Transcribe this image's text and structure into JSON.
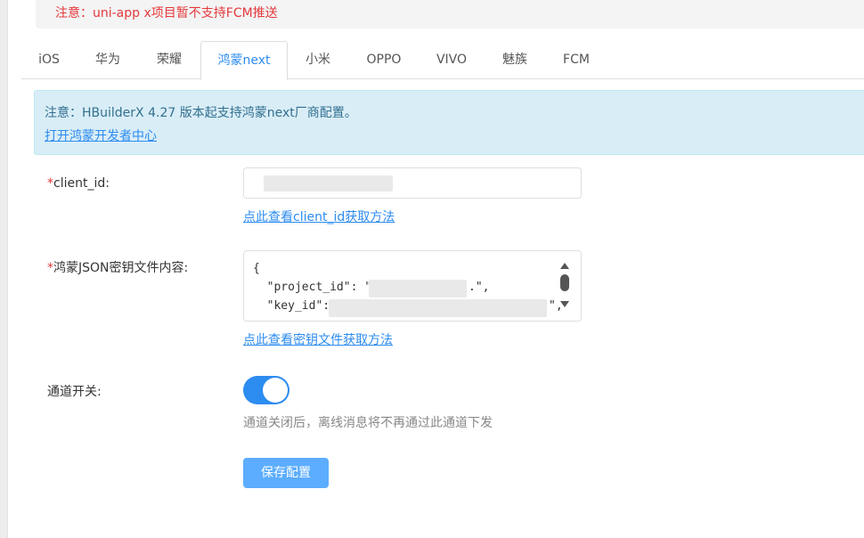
{
  "notice": {
    "text": "注意：uni-app x项目暂不支持FCM推送"
  },
  "tabs": [
    {
      "label": "iOS"
    },
    {
      "label": "华为"
    },
    {
      "label": "荣耀"
    },
    {
      "label": "鸿蒙next",
      "active": true
    },
    {
      "label": "小米"
    },
    {
      "label": "OPPO"
    },
    {
      "label": "VIVO"
    },
    {
      "label": "魅族"
    },
    {
      "label": "FCM"
    }
  ],
  "info": {
    "text": "注意：HBuilderX 4.27 版本起支持鸿蒙next厂商配置。",
    "link": "打开鸿蒙开发者中心"
  },
  "form": {
    "client_id": {
      "required_mark": "*",
      "label": "client_id:",
      "help": "点此查看client_id获取方法"
    },
    "json_key": {
      "required_mark": "*",
      "label": "鸿蒙JSON密钥文件内容:",
      "lines": [
        "{",
        "  \"project_id\": \"",
        "  \"key_id\": \""
      ],
      "line2_end": ".\",",
      "line3_end": "\",",
      "help": "点此查看密钥文件获取方法"
    },
    "switch": {
      "label": "通道开关:",
      "on": true,
      "desc": "通道关闭后，离线消息将不再通过此通道下发"
    },
    "save_label": "保存配置"
  },
  "colors": {
    "accent": "#2d8cf0",
    "danger": "#e4393c",
    "info_bg": "#d9edf7",
    "button": "#5cadff"
  }
}
